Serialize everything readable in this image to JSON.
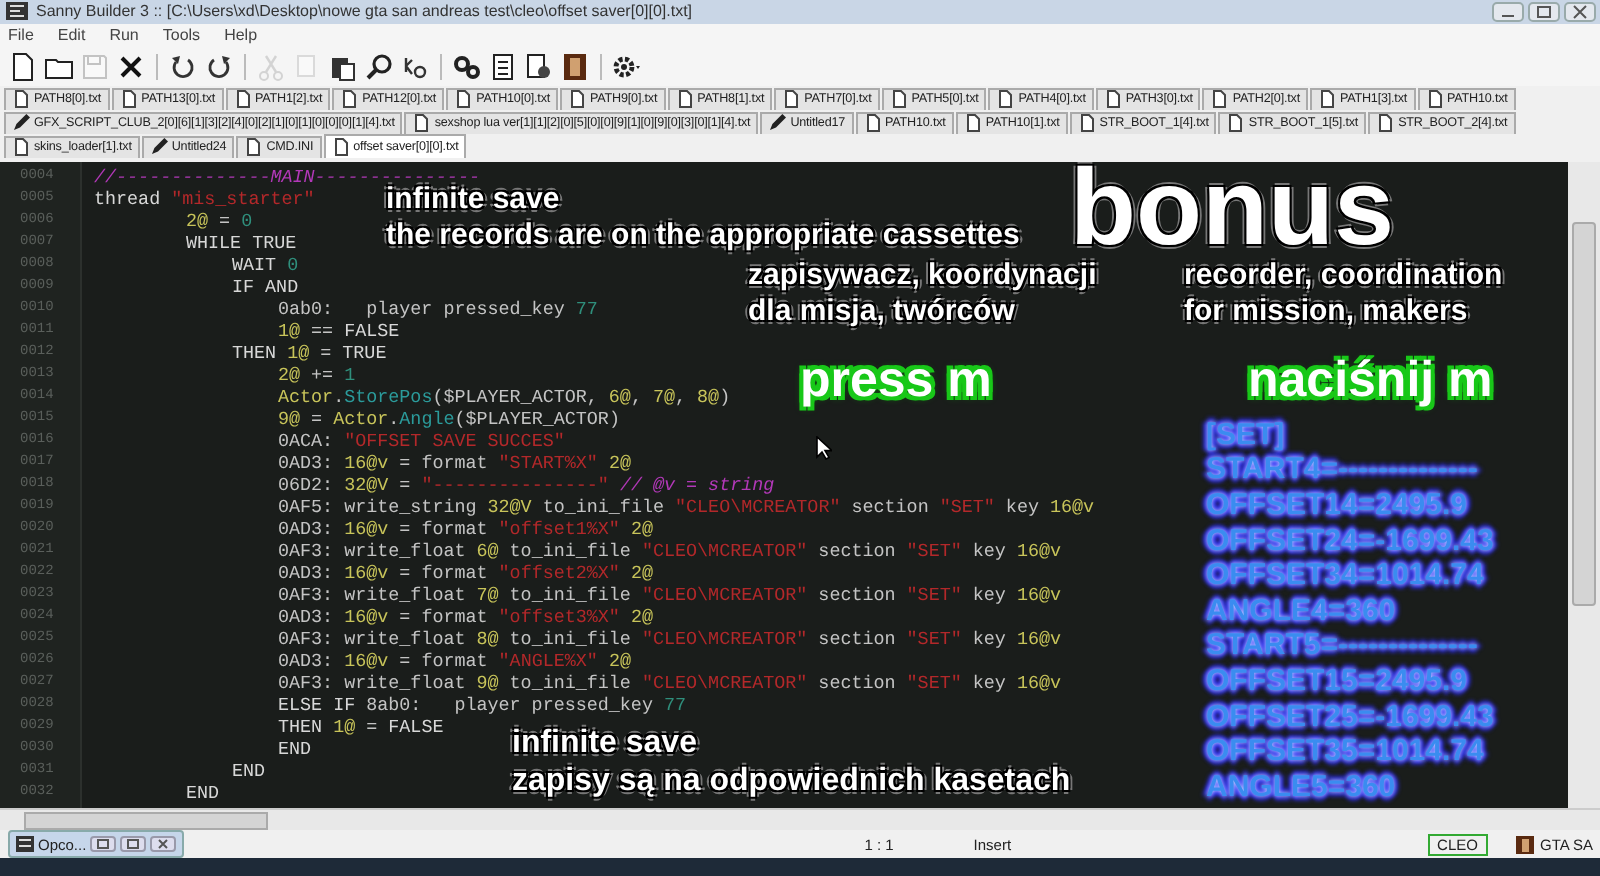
{
  "window": {
    "title": "Sanny Builder 3 :: [C:\\Users\\xd\\Desktop\\nowe gta san andreas test\\cleo\\offset saver[0][0].txt]"
  },
  "menu": [
    "File",
    "Edit",
    "Run",
    "Tools",
    "Help"
  ],
  "toolbar": [
    {
      "disabled": false
    },
    {
      "disabled": false
    },
    {
      "disabled": true
    },
    {
      "disabled": false
    },
    {
      "disabled": false
    },
    {
      "disabled": false
    },
    {
      "disabled": true
    },
    {
      "disabled": true
    },
    {
      "disabled": false
    },
    {
      "disabled": false
    },
    {
      "disabled": false
    },
    {
      "disabled": false
    },
    {
      "disabled": false
    },
    {
      "disabled": false
    },
    {
      "disabled": false
    },
    {
      "disabled": false
    }
  ],
  "tab_rows": [
    [
      {
        "label": "PATH8[0].txt",
        "modified": false,
        "selected": false
      },
      {
        "label": "PATH13[0].txt",
        "modified": false,
        "selected": false
      },
      {
        "label": "PATH1[2].txt",
        "modified": false,
        "selected": false
      },
      {
        "label": "PATH12[0].txt",
        "modified": false,
        "selected": false
      },
      {
        "label": "PATH10[0].txt",
        "modified": false,
        "selected": false
      },
      {
        "label": "PATH9[0].txt",
        "modified": false,
        "selected": false
      },
      {
        "label": "PATH8[1].txt",
        "modified": false,
        "selected": false
      },
      {
        "label": "PATH7[0].txt",
        "modified": false,
        "selected": false
      },
      {
        "label": "PATH5[0].txt",
        "modified": false,
        "selected": false
      },
      {
        "label": "PATH4[0].txt",
        "modified": false,
        "selected": false
      },
      {
        "label": "PATH3[0].txt",
        "modified": false,
        "selected": false
      },
      {
        "label": "PATH2[0].txt",
        "modified": false,
        "selected": false
      },
      {
        "label": "PATH1[3].txt",
        "modified": false,
        "selected": false
      },
      {
        "label": "PATH10.txt",
        "modified": false,
        "selected": false
      }
    ],
    [
      {
        "label": "GFX_SCRIPT_CLUB_2[0][6][1][3][2][4][0][2][1][0][1][0][0][0][1][4].txt",
        "modified": true,
        "selected": false
      },
      {
        "label": "sexshop lua ver[1][1][2][0][5][0][0][9][1][0][9][0][3][0][1][4].txt",
        "modified": false,
        "selected": false
      },
      {
        "label": "Untitled17",
        "modified": true,
        "selected": false
      },
      {
        "label": "PATH10.txt",
        "modified": false,
        "selected": false
      },
      {
        "label": "PATH10[1].txt",
        "modified": false,
        "selected": false
      },
      {
        "label": "STR_BOOT_1[4].txt",
        "modified": false,
        "selected": false
      },
      {
        "label": "STR_BOOT_1[5].txt",
        "modified": false,
        "selected": false
      },
      {
        "label": "STR_BOOT_2[4].txt",
        "modified": false,
        "selected": false
      }
    ],
    [
      {
        "label": "skins_loader[1].txt",
        "modified": false,
        "selected": false
      },
      {
        "label": "Untitled24",
        "modified": true,
        "selected": false
      },
      {
        "label": "CMD.INI",
        "modified": false,
        "selected": false
      },
      {
        "label": "offset saver[0][0].txt",
        "modified": false,
        "selected": true
      }
    ]
  ],
  "code": [
    {
      "number": "0004",
      "tokens": [
        {
          "kind": "comment",
          "text": "//--------------MAIN---------------"
        }
      ]
    },
    {
      "number": "0005",
      "tokens": [
        {
          "kind": "kw",
          "text": "thread "
        },
        {
          "kind": "str",
          "text": "\"mis_starter\""
        }
      ],
      "children": [
        {
          "number": "0006",
          "tokens": [
            {
              "kind": "var",
              "text": "2@"
            },
            {
              "kind": "plain",
              "text": " = "
            },
            {
              "kind": "num",
              "text": "0"
            }
          ]
        },
        {
          "number": "0007",
          "tokens": [
            {
              "kind": "kw",
              "text": "WHILE TRUE"
            }
          ],
          "children": [
            {
              "number": "0008",
              "tokens": [
                {
                  "kind": "kw",
                  "text": "WAIT "
                },
                {
                  "kind": "num",
                  "text": "0"
                }
              ]
            },
            {
              "number": "0009",
              "tokens": [
                {
                  "kind": "kw",
                  "text": "IF AND"
                }
              ],
              "children": [
                {
                  "number": "0010",
                  "tokens": [
                    {
                      "kind": "plain",
                      "text": "0ab0:   player pressed_key "
                    },
                    {
                      "kind": "num",
                      "text": "77"
                    }
                  ]
                },
                {
                  "number": "0011",
                  "tokens": [
                    {
                      "kind": "var",
                      "text": "1@"
                    },
                    {
                      "kind": "plain",
                      "text": " == "
                    },
                    {
                      "kind": "kw",
                      "text": "FALSE"
                    }
                  ]
                }
              ]
            },
            {
              "number": "0012",
              "tokens": [
                {
                  "kind": "kw",
                  "text": "THEN "
                },
                {
                  "kind": "var",
                  "text": "1@"
                },
                {
                  "kind": "plain",
                  "text": " = "
                },
                {
                  "kind": "kw",
                  "text": "TRUE"
                }
              ],
              "children": [
                {
                  "number": "0013",
                  "tokens": [
                    {
                      "kind": "var",
                      "text": "2@"
                    },
                    {
                      "kind": "plain",
                      "text": " += "
                    },
                    {
                      "kind": "num",
                      "text": "1"
                    }
                  ]
                },
                {
                  "number": "0014",
                  "tokens": [
                    {
                      "kind": "cls",
                      "text": "Actor"
                    },
                    {
                      "kind": "plain",
                      "text": "."
                    },
                    {
                      "kind": "meth",
                      "text": "StorePos"
                    },
                    {
                      "kind": "plain",
                      "text": "($PLAYER_ACTOR, "
                    },
                    {
                      "kind": "var",
                      "text": "6@"
                    },
                    {
                      "kind": "plain",
                      "text": ", "
                    },
                    {
                      "kind": "var",
                      "text": "7@"
                    },
                    {
                      "kind": "plain",
                      "text": ", "
                    },
                    {
                      "kind": "var",
                      "text": "8@"
                    },
                    {
                      "kind": "plain",
                      "text": ")"
                    }
                  ]
                },
                {
                  "number": "0015",
                  "tokens": [
                    {
                      "kind": "var",
                      "text": "9@"
                    },
                    {
                      "kind": "plain",
                      "text": " = "
                    },
                    {
                      "kind": "cls",
                      "text": "Actor"
                    },
                    {
                      "kind": "plain",
                      "text": "."
                    },
                    {
                      "kind": "meth",
                      "text": "Angle"
                    },
                    {
                      "kind": "plain",
                      "text": "($PLAYER_ACTOR)"
                    }
                  ]
                },
                {
                  "number": "0016",
                  "tokens": [
                    {
                      "kind": "plain",
                      "text": "0ACA: "
                    },
                    {
                      "kind": "str",
                      "text": "\"OFFSET SAVE SUCCES\""
                    }
                  ]
                },
                {
                  "number": "0017",
                  "tokens": [
                    {
                      "kind": "plain",
                      "text": "0AD3: "
                    },
                    {
                      "kind": "var",
                      "text": "16@v"
                    },
                    {
                      "kind": "plain",
                      "text": " = format "
                    },
                    {
                      "kind": "str",
                      "text": "\"START%X\" "
                    },
                    {
                      "kind": "var",
                      "text": "2@"
                    }
                  ]
                },
                {
                  "number": "0018",
                  "tokens": [
                    {
                      "kind": "plain",
                      "text": "06D2: "
                    },
                    {
                      "kind": "var",
                      "text": "32@V"
                    },
                    {
                      "kind": "plain",
                      "text": " = "
                    },
                    {
                      "kind": "str",
                      "text": "\"---------------\""
                    },
                    {
                      "kind": "comment",
                      "text": " // @v = string"
                    }
                  ]
                },
                {
                  "number": "0019",
                  "tokens": [
                    {
                      "kind": "plain",
                      "text": "0AF5: write_string "
                    },
                    {
                      "kind": "var",
                      "text": "32@V"
                    },
                    {
                      "kind": "plain",
                      "text": " to_ini_file "
                    },
                    {
                      "kind": "str",
                      "text": "\"CLEO\\MCREATOR\""
                    },
                    {
                      "kind": "plain",
                      "text": " section "
                    },
                    {
                      "kind": "str",
                      "text": "\"SET\""
                    },
                    {
                      "kind": "plain",
                      "text": " key "
                    },
                    {
                      "kind": "var",
                      "text": "16@v"
                    }
                  ]
                },
                {
                  "number": "0020",
                  "tokens": [
                    {
                      "kind": "plain",
                      "text": "0AD3: "
                    },
                    {
                      "kind": "var",
                      "text": "16@v"
                    },
                    {
                      "kind": "plain",
                      "text": " = format "
                    },
                    {
                      "kind": "str",
                      "text": "\"offset1%X\" "
                    },
                    {
                      "kind": "var",
                      "text": "2@"
                    }
                  ]
                },
                {
                  "number": "0021",
                  "tokens": [
                    {
                      "kind": "plain",
                      "text": "0AF3: write_float "
                    },
                    {
                      "kind": "var",
                      "text": "6@"
                    },
                    {
                      "kind": "plain",
                      "text": " to_ini_file "
                    },
                    {
                      "kind": "str",
                      "text": "\"CLEO\\MCREATOR\""
                    },
                    {
                      "kind": "plain",
                      "text": " section "
                    },
                    {
                      "kind": "str",
                      "text": "\"SET\""
                    },
                    {
                      "kind": "plain",
                      "text": " key "
                    },
                    {
                      "kind": "var",
                      "text": "16@v"
                    }
                  ]
                },
                {
                  "number": "0022",
                  "tokens": [
                    {
                      "kind": "plain",
                      "text": "0AD3: "
                    },
                    {
                      "kind": "var",
                      "text": "16@v"
                    },
                    {
                      "kind": "plain",
                      "text": " = format "
                    },
                    {
                      "kind": "str",
                      "text": "\"offset2%X\" "
                    },
                    {
                      "kind": "var",
                      "text": "2@"
                    }
                  ]
                },
                {
                  "number": "0023",
                  "tokens": [
                    {
                      "kind": "plain",
                      "text": "0AF3: write_float "
                    },
                    {
                      "kind": "var",
                      "text": "7@"
                    },
                    {
                      "kind": "plain",
                      "text": " to_ini_file "
                    },
                    {
                      "kind": "str",
                      "text": "\"CLEO\\MCREATOR\""
                    },
                    {
                      "kind": "plain",
                      "text": " section "
                    },
                    {
                      "kind": "str",
                      "text": "\"SET\""
                    },
                    {
                      "kind": "plain",
                      "text": " key "
                    },
                    {
                      "kind": "var",
                      "text": "16@v"
                    }
                  ]
                },
                {
                  "number": "0024",
                  "tokens": [
                    {
                      "kind": "plain",
                      "text": "0AD3: "
                    },
                    {
                      "kind": "var",
                      "text": "16@v"
                    },
                    {
                      "kind": "plain",
                      "text": " = format "
                    },
                    {
                      "kind": "str",
                      "text": "\"offset3%X\" "
                    },
                    {
                      "kind": "var",
                      "text": "2@"
                    }
                  ]
                },
                {
                  "number": "0025",
                  "tokens": [
                    {
                      "kind": "plain",
                      "text": "0AF3: write_float "
                    },
                    {
                      "kind": "var",
                      "text": "8@"
                    },
                    {
                      "kind": "plain",
                      "text": " to_ini_file "
                    },
                    {
                      "kind": "str",
                      "text": "\"CLEO\\MCREATOR\""
                    },
                    {
                      "kind": "plain",
                      "text": " section "
                    },
                    {
                      "kind": "str",
                      "text": "\"SET\""
                    },
                    {
                      "kind": "plain",
                      "text": " key "
                    },
                    {
                      "kind": "var",
                      "text": "16@v"
                    }
                  ]
                },
                {
                  "number": "0026",
                  "tokens": [
                    {
                      "kind": "plain",
                      "text": "0AD3: "
                    },
                    {
                      "kind": "var",
                      "text": "16@v"
                    },
                    {
                      "kind": "plain",
                      "text": " = format "
                    },
                    {
                      "kind": "str",
                      "text": "\"ANGLE%X\" "
                    },
                    {
                      "kind": "var",
                      "text": "2@"
                    }
                  ]
                },
                {
                  "number": "0027",
                  "tokens": [
                    {
                      "kind": "plain",
                      "text": "0AF3: write_float "
                    },
                    {
                      "kind": "var",
                      "text": "9@"
                    },
                    {
                      "kind": "plain",
                      "text": " to_ini_file "
                    },
                    {
                      "kind": "str",
                      "text": "\"CLEO\\MCREATOR\""
                    },
                    {
                      "kind": "plain",
                      "text": " section "
                    },
                    {
                      "kind": "str",
                      "text": "\"SET\""
                    },
                    {
                      "kind": "plain",
                      "text": " key "
                    },
                    {
                      "kind": "var",
                      "text": "16@v"
                    }
                  ]
                },
                {
                  "number": "0028",
                  "tokens": [
                    {
                      "kind": "kw",
                      "text": "ELSE IF "
                    },
                    {
                      "kind": "plain",
                      "text": "8ab0:   player pressed_key "
                    },
                    {
                      "kind": "num",
                      "text": "77"
                    }
                  ]
                },
                {
                  "number": "0029",
                  "tokens": [
                    {
                      "kind": "kw",
                      "text": "THEN "
                    },
                    {
                      "kind": "var",
                      "text": "1@"
                    },
                    {
                      "kind": "plain",
                      "text": " = "
                    },
                    {
                      "kind": "kw",
                      "text": "FALSE"
                    }
                  ]
                },
                {
                  "number": "0030",
                  "tokens": [
                    {
                      "kind": "kw",
                      "text": "END"
                    }
                  ]
                }
              ]
            },
            {
              "number": "0031",
              "tokens": [
                {
                  "kind": "kw",
                  "text": "END"
                }
              ]
            }
          ]
        },
        {
          "number": "0032",
          "tokens": [
            {
              "kind": "kw",
              "text": "END"
            }
          ]
        }
      ]
    }
  ],
  "overlays": [
    {
      "kind": "caption",
      "lines": [
        "infinite save",
        "the records are on the appropriate cassettes"
      ]
    },
    {
      "kind": "title",
      "lines": [
        "bonus"
      ]
    },
    {
      "kind": "caption",
      "lines": [
        "zapisywacz, koordynacji",
        "dla misja, twórców"
      ]
    },
    {
      "kind": "caption",
      "lines": [
        "recorder, coordination",
        "for mission, makers"
      ]
    },
    {
      "kind": "key",
      "lines": [
        "press m"
      ]
    },
    {
      "kind": "key",
      "lines": [
        "naciśnij m"
      ]
    },
    {
      "kind": "caption",
      "lines": [
        "infinite save",
        "zapisy są na odpowiednich kasetach"
      ]
    },
    {
      "kind": "ini",
      "lines": [
        "[SET]",
        "START4=--------------",
        "OFFSET14=2495.9",
        "OFFSET24=-1699.43",
        "OFFSET34=1014.74",
        "ANGLE4=360",
        "START5=--------------",
        "OFFSET15=2495.9",
        "OFFSET25=-1699.43",
        "OFFSET35=1014.74",
        "ANGLE5=360"
      ]
    }
  ],
  "status_bar": {
    "position": "1 : 1",
    "mode": "Insert",
    "script_type": "CLEO",
    "game": "GTA SA"
  },
  "minimized_window": {
    "title": "Opco..."
  }
}
